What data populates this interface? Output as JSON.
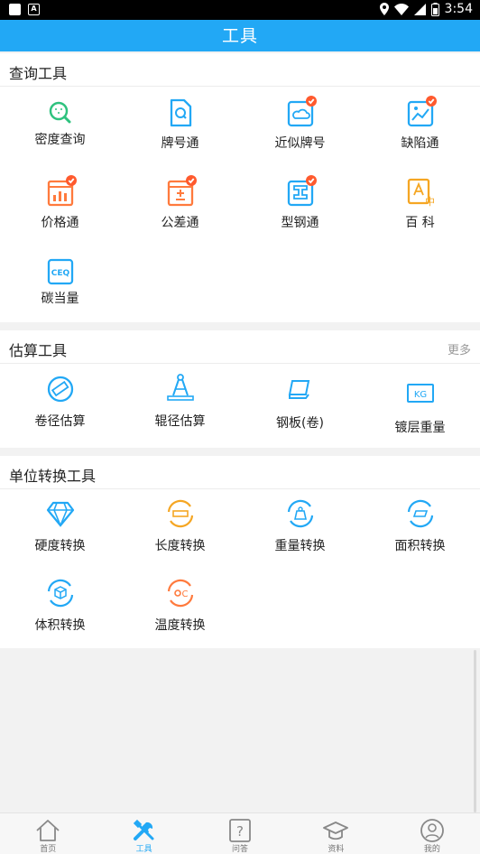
{
  "status_bar": {
    "time": "3:54"
  },
  "app_bar": {
    "title": "工具"
  },
  "sections": {
    "query": {
      "title": "查询工具",
      "items": [
        {
          "label": "密度查询",
          "icon": "magnifier-icon"
        },
        {
          "label": "牌号通",
          "icon": "document-search-icon"
        },
        {
          "label": "近似牌号",
          "icon": "cloud-tag-icon"
        },
        {
          "label": "缺陷通",
          "icon": "chart-photo-icon"
        },
        {
          "label": "价格通",
          "icon": "price-chart-icon"
        },
        {
          "label": "公差通",
          "icon": "plus-minus-icon"
        },
        {
          "label": "型钢通",
          "icon": "i-beam-icon"
        },
        {
          "label": "百 科",
          "icon": "encyclopedia-icon"
        },
        {
          "label": "碳当量",
          "icon": "ceq-icon"
        }
      ]
    },
    "estimate": {
      "title": "估算工具",
      "more": "更多",
      "items": [
        {
          "label": "卷径估算",
          "icon": "coil-ruler-icon"
        },
        {
          "label": "辊径估算",
          "icon": "compass-icon"
        },
        {
          "label": "钢板(卷)",
          "icon": "steel-plate-icon"
        },
        {
          "label": "镀层重量",
          "icon": "kg-icon"
        }
      ]
    },
    "convert": {
      "title": "单位转换工具",
      "items": [
        {
          "label": "硬度转换",
          "icon": "diamond-icon"
        },
        {
          "label": "长度转换",
          "icon": "length-convert-icon"
        },
        {
          "label": "重量转换",
          "icon": "weight-convert-icon"
        },
        {
          "label": "面积转换",
          "icon": "area-convert-icon"
        },
        {
          "label": "体积转换",
          "icon": "volume-convert-icon"
        },
        {
          "label": "温度转换",
          "icon": "temperature-convert-icon"
        }
      ]
    }
  },
  "tab_bar": {
    "items": [
      {
        "label": "首页",
        "icon": "home-icon"
      },
      {
        "label": "工具",
        "icon": "tools-icon",
        "active": true
      },
      {
        "label": "问答",
        "icon": "question-icon"
      },
      {
        "label": "资料",
        "icon": "graduation-cap-icon"
      },
      {
        "label": "我的",
        "icon": "user-icon"
      }
    ]
  },
  "colors": {
    "primary": "#22a8f5",
    "orange": "#ff7a3d",
    "yellow": "#f5a623",
    "green": "#2ec27e",
    "badge": "#ff5a2e"
  }
}
